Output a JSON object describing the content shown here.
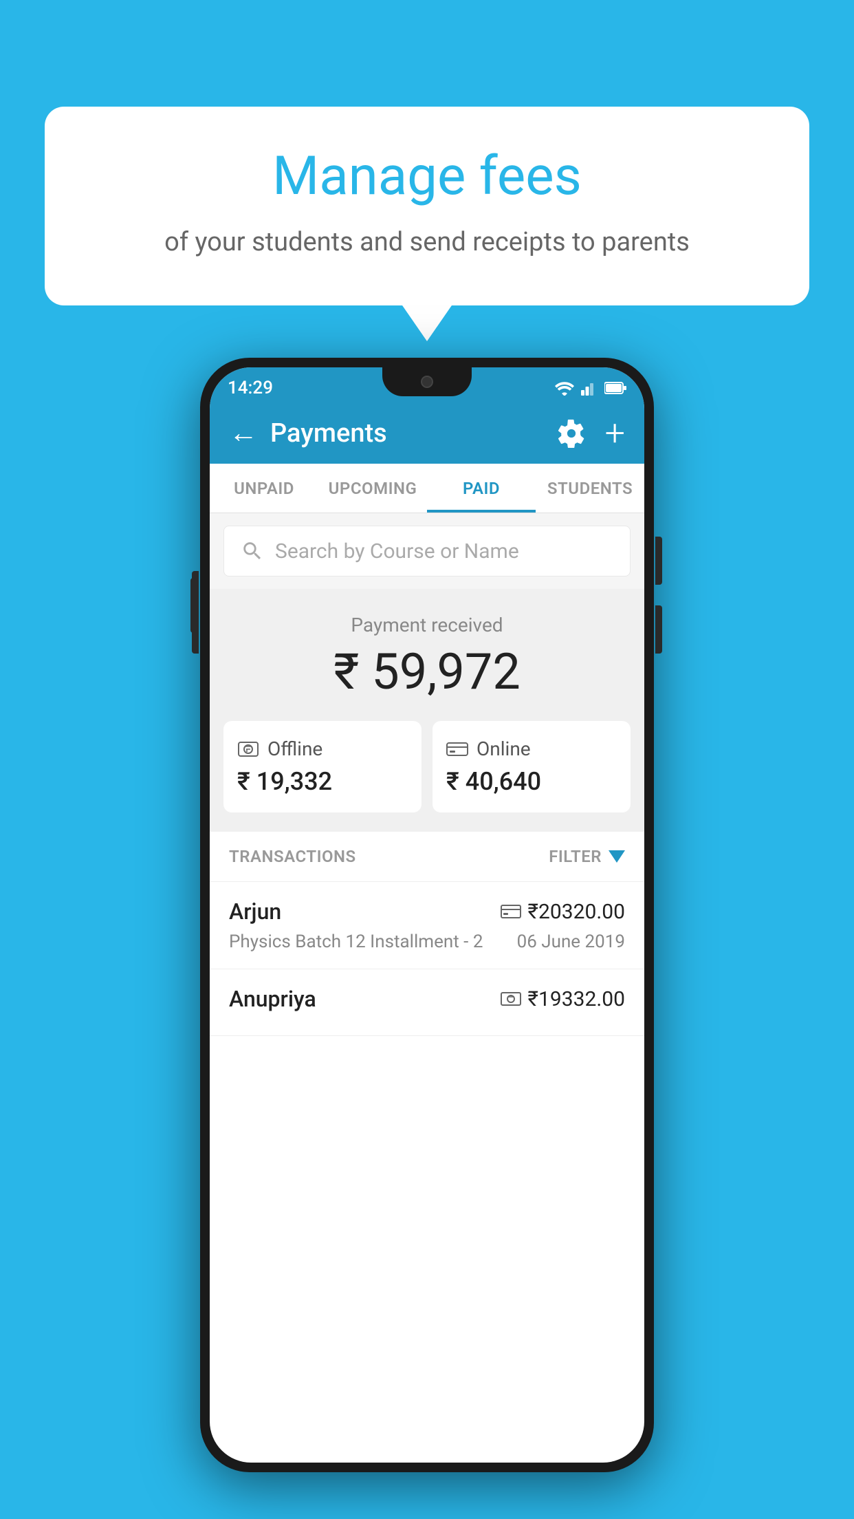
{
  "background": {
    "color": "#29b6e8"
  },
  "speech_bubble": {
    "title": "Manage fees",
    "subtitle": "of your students and send receipts to parents"
  },
  "status_bar": {
    "time": "14:29",
    "wifi": "wifi",
    "signal": "signal",
    "battery": "battery"
  },
  "header": {
    "back_label": "←",
    "title": "Payments",
    "gear": "gear",
    "plus": "+"
  },
  "tabs": [
    {
      "label": "UNPAID",
      "active": false
    },
    {
      "label": "UPCOMING",
      "active": false
    },
    {
      "label": "PAID",
      "active": true
    },
    {
      "label": "STUDENTS",
      "active": false
    }
  ],
  "search": {
    "placeholder": "Search by Course or Name"
  },
  "payment_received": {
    "label": "Payment received",
    "amount": "₹ 59,972"
  },
  "payment_cards": [
    {
      "type": "Offline",
      "amount": "₹ 19,332",
      "icon": "cash"
    },
    {
      "type": "Online",
      "amount": "₹ 40,640",
      "icon": "card"
    }
  ],
  "transactions_section": {
    "label": "TRANSACTIONS",
    "filter_label": "FILTER"
  },
  "transactions": [
    {
      "name": "Arjun",
      "description": "Physics Batch 12 Installment - 2",
      "amount": "₹20320.00",
      "date": "06 June 2019",
      "payment_type": "card"
    },
    {
      "name": "Anupriya",
      "description": "",
      "amount": "₹19332.00",
      "date": "",
      "payment_type": "cash"
    }
  ]
}
